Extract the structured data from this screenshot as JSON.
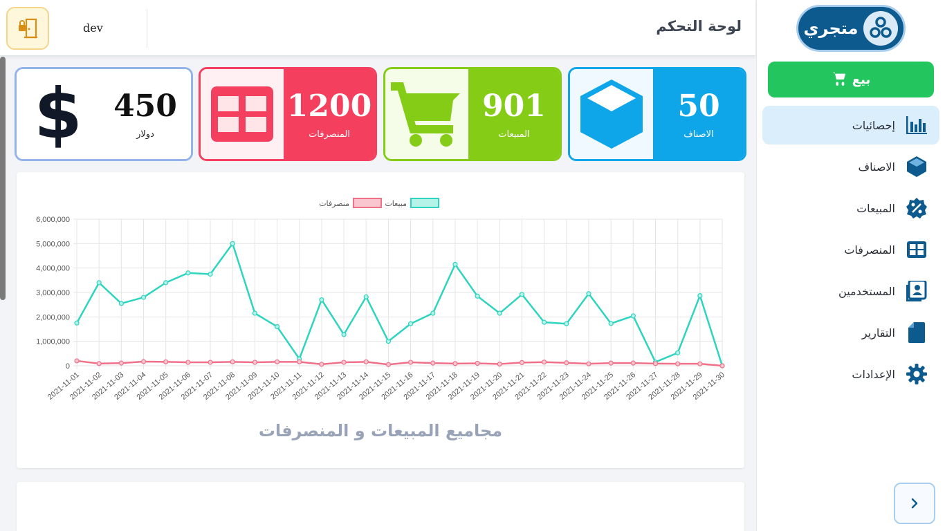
{
  "app": {
    "logo_text": "متجري"
  },
  "header": {
    "title": "لوحة التحكم",
    "username": "dev"
  },
  "sidebar": {
    "sell_label": "بيع",
    "items": [
      {
        "label": "إحصائيات",
        "icon": "bar-chart-icon",
        "active": true
      },
      {
        "label": "الاصناف",
        "icon": "cube-icon",
        "active": false
      },
      {
        "label": "المبيعات",
        "icon": "sale-badge-icon",
        "active": false
      },
      {
        "label": "المنصرفات",
        "icon": "grid-table-icon",
        "active": false
      },
      {
        "label": "المستخدمين",
        "icon": "user-contact-icon",
        "active": false
      },
      {
        "label": "التقارير",
        "icon": "document-icon",
        "active": false
      },
      {
        "label": "الإعدادات",
        "icon": "gear-icon",
        "active": false
      }
    ]
  },
  "cards": [
    {
      "value": "50",
      "label": "الاصناف",
      "color": "#0ea5e9",
      "icon": "cube-icon"
    },
    {
      "value": "901",
      "label": "المبيعات",
      "color": "#84cc16",
      "icon": "cart-icon"
    },
    {
      "value": "1200",
      "label": "المنصرفات",
      "color": "#f43f5e",
      "icon": "grid-table-icon"
    },
    {
      "value": "450",
      "label": "دولار",
      "color": "#93b4e8",
      "icon": "dollar-icon"
    }
  ],
  "colors": {
    "primary": "#0d5a8f",
    "sell": "#22c55e",
    "sales_line": "#2dd4bf",
    "expense_line": "#f0708a"
  },
  "chart_data": {
    "type": "line",
    "title": "مجاميع المبيعات و المنصرفات",
    "legend": [
      "مبيعات",
      "منصرفات"
    ],
    "legend_position": "top",
    "grid": true,
    "ylim": [
      0,
      6000000
    ],
    "yticks": [
      "0",
      "1,000,000",
      "2,000,000",
      "3,000,000",
      "4,000,000",
      "5,000,000",
      "6,000,000"
    ],
    "x": [
      "2021-11-01",
      "2021-11-02",
      "2021-11-03",
      "2021-11-04",
      "2021-11-05",
      "2021-11-06",
      "2021-11-07",
      "2021-11-08",
      "2021-11-09",
      "2021-11-10",
      "2021-11-11",
      "2021-11-12",
      "2021-11-13",
      "2021-11-14",
      "2021-11-15",
      "2021-11-16",
      "2021-11-17",
      "2021-11-18",
      "2021-11-19",
      "2021-11-20",
      "2021-11-21",
      "2021-11-22",
      "2021-11-23",
      "2021-11-24",
      "2021-11-25",
      "2021-11-26",
      "2021-11-27",
      "2021-11-28",
      "2021-11-29",
      "2021-11-30"
    ],
    "series": [
      {
        "name": "مبيعات",
        "values": [
          1750000,
          3400000,
          2550000,
          2800000,
          3400000,
          3800000,
          3750000,
          5000000,
          2150000,
          1600000,
          280000,
          2700000,
          1280000,
          2820000,
          1000000,
          1720000,
          2150000,
          4150000,
          2850000,
          2150000,
          2920000,
          1780000,
          1720000,
          2950000,
          1730000,
          2040000,
          150000,
          530000,
          2870000,
          0
        ]
      },
      {
        "name": "منصرفات",
        "values": [
          200000,
          90000,
          110000,
          170000,
          160000,
          140000,
          140000,
          160000,
          140000,
          160000,
          160000,
          60000,
          140000,
          160000,
          50000,
          140000,
          110000,
          90000,
          100000,
          70000,
          130000,
          150000,
          120000,
          80000,
          110000,
          110000,
          90000,
          80000,
          80000,
          0
        ]
      }
    ]
  }
}
